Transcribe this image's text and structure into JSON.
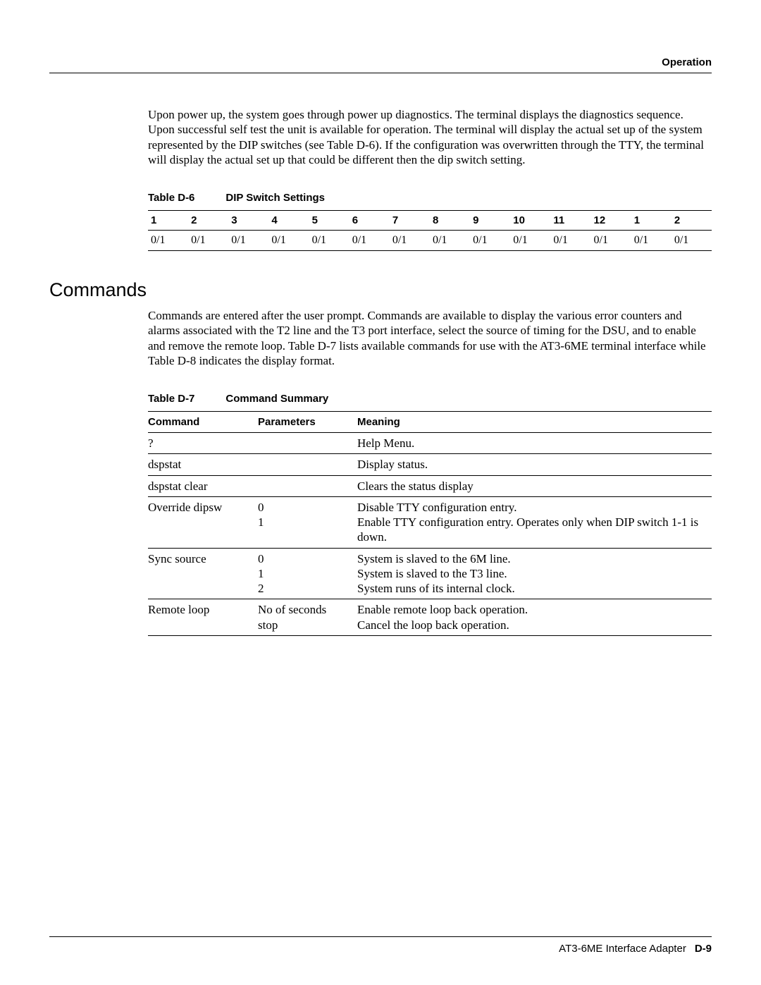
{
  "header": {
    "running": "Operation"
  },
  "para1": "Upon power up, the system goes through power up diagnostics. The terminal displays the diagnostics sequence. Upon successful self test the unit is available for operation. The terminal will display the actual set up of the system represented by the DIP switches (see Table D-6). If the configuration was overwritten through the TTY, the terminal will display the actual set up that could be different then the dip switch setting.",
  "tableD6": {
    "label": "Table D-6",
    "title": "DIP Switch Settings",
    "headers": [
      "1",
      "2",
      "3",
      "4",
      "5",
      "6",
      "7",
      "8",
      "9",
      "10",
      "11",
      "12",
      "1",
      "2"
    ],
    "row": [
      "0/1",
      "0/1",
      "0/1",
      "0/1",
      "0/1",
      "0/1",
      "0/1",
      "0/1",
      "0/1",
      "0/1",
      "0/1",
      "0/1",
      "0/1",
      "0/1"
    ]
  },
  "section_commands": {
    "heading": "Commands",
    "para": "Commands are entered after the user prompt. Commands are available to display the various error counters and alarms associated with the T2 line and the T3 port interface, select the source of timing for the DSU, and to enable and remove the remote loop. Table D-7 lists available commands for use with the AT3-6ME terminal interface while Table D-8 indicates the display format."
  },
  "tableD7": {
    "label": "Table D-7",
    "title": "Command Summary",
    "cols": {
      "c1": "Command",
      "c2": "Parameters",
      "c3": "Meaning"
    },
    "rows": [
      {
        "cmd": "?",
        "par": "",
        "mean": "Help Menu."
      },
      {
        "cmd": "dspstat",
        "par": "",
        "mean": "Display status."
      },
      {
        "cmd": "dspstat clear",
        "par": "",
        "mean": "Clears the status display"
      },
      {
        "cmd": "Override dipsw",
        "par": "0\n1",
        "mean": "Disable TTY configuration entry.\nEnable TTY configuration entry.  Operates only when DIP switch 1-1 is down."
      },
      {
        "cmd": "Sync source",
        "par": "0\n1\n2",
        "mean": "System is slaved to the 6M line.\nSystem is slaved to the T3 line.\nSystem runs of its internal clock."
      },
      {
        "cmd": "Remote loop",
        "par": "No of seconds\nstop",
        "mean": "Enable remote loop back operation.\nCancel the loop back operation."
      }
    ]
  },
  "footer": {
    "source": "AT3-6ME Interface Adapter",
    "page": "D-9"
  }
}
